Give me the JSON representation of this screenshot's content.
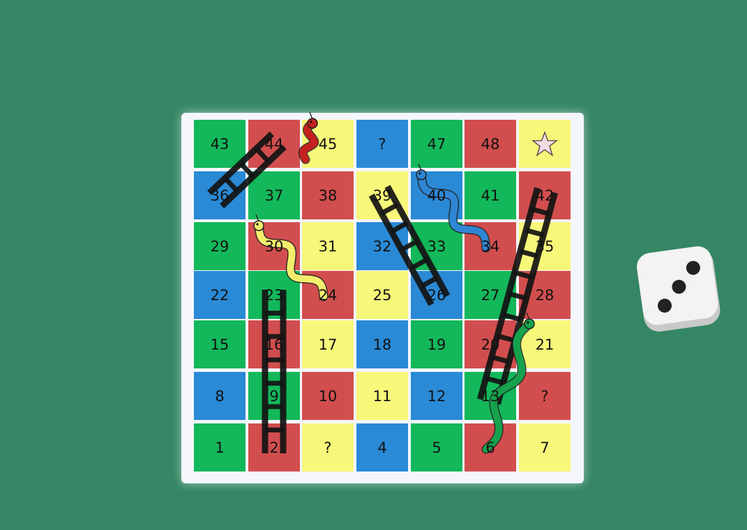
{
  "colors": {
    "background": "#358664",
    "board": "#f4f6fb",
    "green": "#13b85a",
    "red": "#d24e4e",
    "yellow": "#f7f77a",
    "blue": "#2a8ad6",
    "ladder": "#141414",
    "goal_star": "#f3dbe3"
  },
  "board": {
    "cells": [
      {
        "label": "43",
        "color": "green"
      },
      {
        "label": "44",
        "color": "red"
      },
      {
        "label": "45",
        "color": "yellow"
      },
      {
        "label": "?",
        "color": "blue"
      },
      {
        "label": "47",
        "color": "green"
      },
      {
        "label": "48",
        "color": "red"
      },
      {
        "label": "",
        "color": "yellow",
        "icon": "star-icon"
      },
      {
        "label": "36",
        "color": "blue"
      },
      {
        "label": "37",
        "color": "green"
      },
      {
        "label": "38",
        "color": "red"
      },
      {
        "label": "39",
        "color": "yellow"
      },
      {
        "label": "40",
        "color": "blue"
      },
      {
        "label": "41",
        "color": "green"
      },
      {
        "label": "42",
        "color": "red"
      },
      {
        "label": "29",
        "color": "green"
      },
      {
        "label": "30",
        "color": "red"
      },
      {
        "label": "31",
        "color": "yellow"
      },
      {
        "label": "32",
        "color": "blue"
      },
      {
        "label": "33",
        "color": "green"
      },
      {
        "label": "34",
        "color": "red"
      },
      {
        "label": "35",
        "color": "yellow"
      },
      {
        "label": "22",
        "color": "blue"
      },
      {
        "label": "23",
        "color": "green"
      },
      {
        "label": "24",
        "color": "red"
      },
      {
        "label": "25",
        "color": "yellow"
      },
      {
        "label": "26",
        "color": "blue"
      },
      {
        "label": "27",
        "color": "green"
      },
      {
        "label": "28",
        "color": "red"
      },
      {
        "label": "15",
        "color": "green"
      },
      {
        "label": "16",
        "color": "red"
      },
      {
        "label": "17",
        "color": "yellow"
      },
      {
        "label": "18",
        "color": "blue"
      },
      {
        "label": "19",
        "color": "green"
      },
      {
        "label": "20",
        "color": "red"
      },
      {
        "label": "21",
        "color": "yellow"
      },
      {
        "label": "8",
        "color": "blue"
      },
      {
        "label": "9",
        "color": "green"
      },
      {
        "label": "10",
        "color": "red"
      },
      {
        "label": "11",
        "color": "yellow"
      },
      {
        "label": "12",
        "color": "blue"
      },
      {
        "label": "13",
        "color": "green"
      },
      {
        "label": "?",
        "color": "red"
      },
      {
        "label": "1",
        "color": "green"
      },
      {
        "label": "2",
        "color": "red"
      },
      {
        "label": "?",
        "color": "yellow"
      },
      {
        "label": "4",
        "color": "blue"
      },
      {
        "label": "5",
        "color": "green"
      },
      {
        "label": "6",
        "color": "red"
      },
      {
        "label": "7",
        "color": "yellow"
      }
    ]
  },
  "ladders": [
    {
      "from": "36",
      "to": "44"
    },
    {
      "from": "2",
      "to": "23"
    },
    {
      "from": "26",
      "to": "39"
    },
    {
      "from": "13",
      "to": "42"
    }
  ],
  "snakes": [
    {
      "head": "45",
      "tail": "45",
      "color": "#c62020"
    },
    {
      "head": "40",
      "tail": "34",
      "color": "#2f86d4"
    },
    {
      "head": "30",
      "tail": "24",
      "color": "#f2ee6c"
    },
    {
      "head": "21",
      "tail": "6",
      "color": "#16a24c"
    }
  ],
  "die": {
    "value": 3
  }
}
